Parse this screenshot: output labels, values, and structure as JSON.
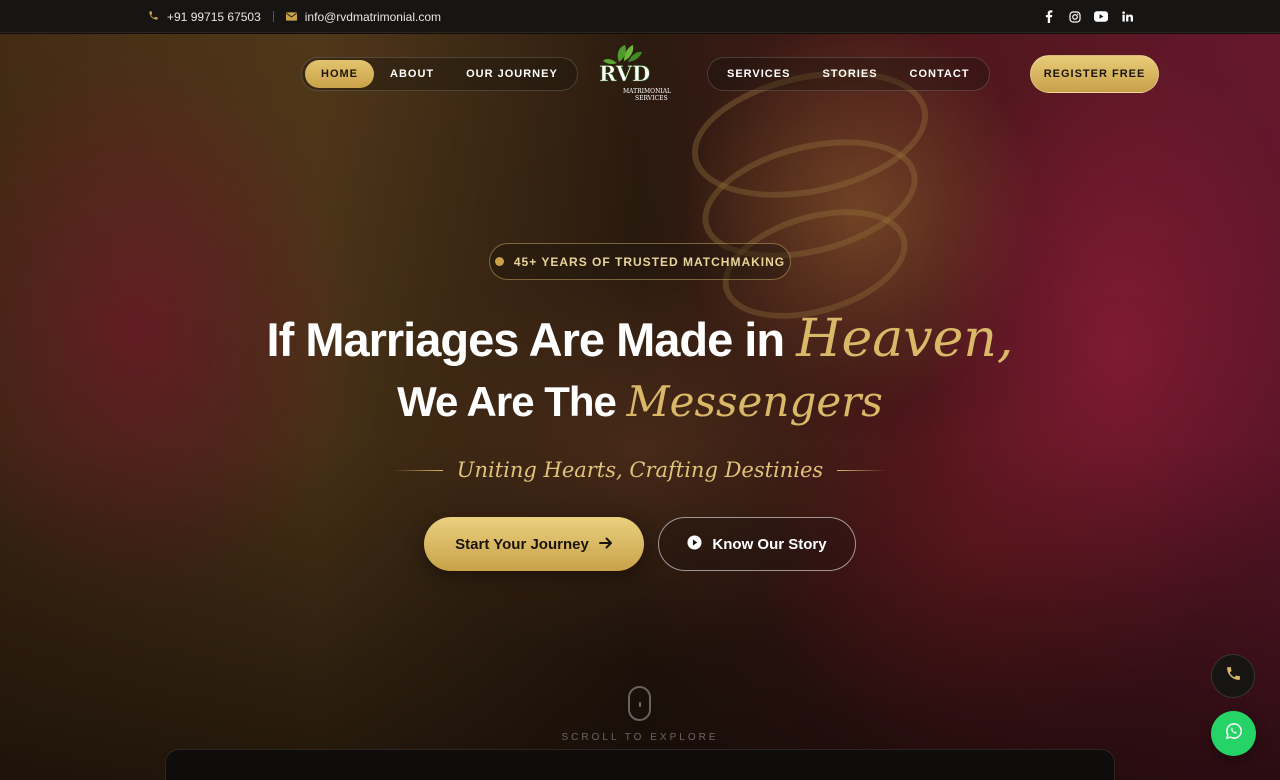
{
  "topbar": {
    "phone": "+91 99715 67503",
    "email": "info@rvdmatrimonial.com",
    "social_icons": [
      "facebook-icon",
      "instagram-icon",
      "youtube-icon",
      "linkedin-icon"
    ]
  },
  "nav": {
    "left": [
      "HOME",
      "ABOUT",
      "OUR JOURNEY"
    ],
    "right": [
      "SERVICES",
      "STORIES",
      "CONTACT"
    ],
    "active": "HOME",
    "register_label": "REGISTER FREE"
  },
  "logo": {
    "name": "RVD",
    "subtitle_line1": "MATRIMONIAL",
    "subtitle_line2": "SERVICES"
  },
  "hero": {
    "badge": "45+ YEARS OF TRUSTED MATCHMAKING",
    "line1_plain": "If Marriages Are Made in ",
    "line1_script": "Heaven,",
    "line2_plain": "We Are The ",
    "line2_script": "Messengers",
    "tagline": "Uniting Hearts, Crafting Destinies",
    "primary_button": "Start Your Journey",
    "secondary_button": "Know Our Story",
    "scroll_text": "SCROLL TO EXPLORE"
  },
  "colors": {
    "gold": "#d9b867",
    "gold_button": "#c9a24a",
    "topbar_bg": "#171513",
    "whatsapp": "#25d366"
  }
}
